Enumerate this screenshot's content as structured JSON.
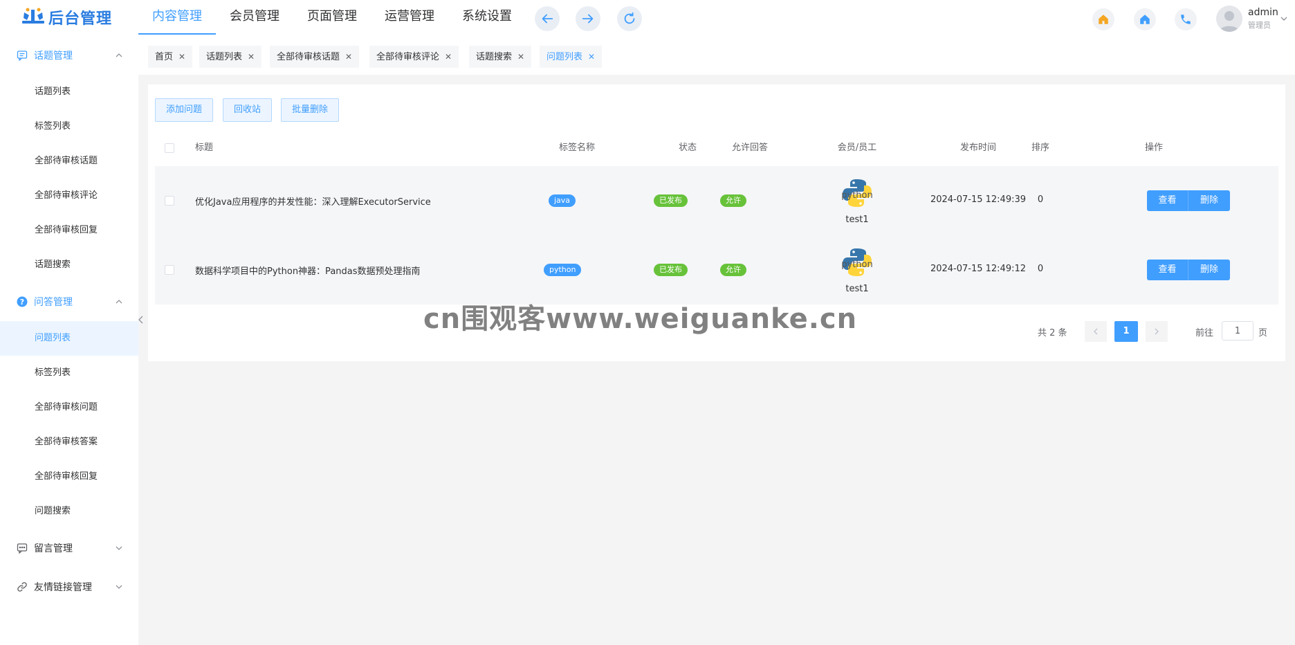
{
  "header": {
    "logo_text": "后台管理",
    "nav": [
      "内容管理",
      "会员管理",
      "页面管理",
      "运营管理",
      "系统设置"
    ],
    "active_nav": 0,
    "user": {
      "name": "admin",
      "role": "管理员"
    }
  },
  "sidebar": {
    "groups": [
      {
        "label": "话题管理",
        "items": [
          "话题列表",
          "标签列表",
          "全部待审核话题",
          "全部待审核评论",
          "全部待审核回复",
          "话题搜索"
        ]
      },
      {
        "label": "问答管理",
        "items": [
          "问题列表",
          "标签列表",
          "全部待审核问题",
          "全部待审核答案",
          "全部待审核回复",
          "问题搜索"
        ]
      },
      {
        "label": "留言管理"
      },
      {
        "label": "友情链接管理"
      }
    ],
    "active_item": "问题列表"
  },
  "tabs": [
    "首页",
    "话题列表",
    "全部待审核话题",
    "全部待审核评论",
    "话题搜索",
    "问题列表"
  ],
  "toolbar": {
    "add": "添加问题",
    "recycle": "回收站",
    "batch_delete": "批量删除"
  },
  "table": {
    "columns": [
      "标题",
      "标签名称",
      "状态",
      "允许回答",
      "会员/员工",
      "发布时间",
      "排序",
      "操作"
    ],
    "rows": [
      {
        "title": "优化Java应用程序的并发性能：深入理解ExecutorService",
        "tag": "java",
        "status": "已发布",
        "allow": "允许",
        "user": "test1",
        "time": "2024-07-15 12:49:39",
        "sort": "0",
        "view": "查看",
        "delete": "删除"
      },
      {
        "title": "数据科学项目中的Python神器：Pandas数据预处理指南",
        "tag": "python",
        "status": "已发布",
        "allow": "允许",
        "user": "test1",
        "time": "2024-07-15 12:49:12",
        "sort": "0",
        "view": "查看",
        "delete": "删除"
      }
    ]
  },
  "pagination": {
    "total": "共 2 条",
    "current": "1",
    "goto": "前往",
    "input": "1",
    "page_unit": "页"
  },
  "watermark": "cn围观客www.weiguanke.cn",
  "colors": {
    "primary": "#409eff",
    "success": "#67c23a",
    "home_orange": "#f5a623"
  }
}
